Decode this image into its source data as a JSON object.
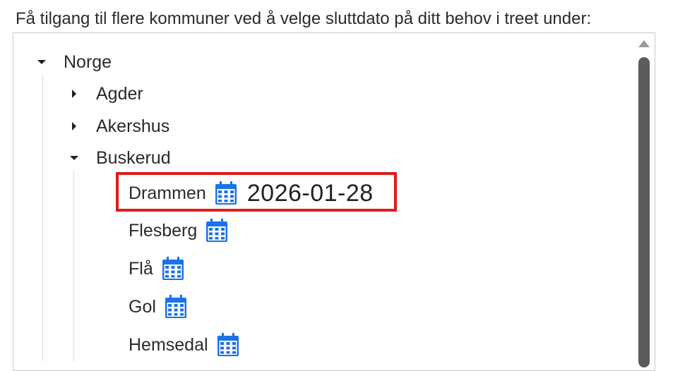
{
  "instruction": "Få tilgang til flere kommuner ved å velge sluttdato på ditt behov i treet under:",
  "tree": {
    "root": {
      "label": "Norge",
      "expanded": true
    },
    "counties": [
      {
        "label": "Agder",
        "expanded": false
      },
      {
        "label": "Akershus",
        "expanded": false
      },
      {
        "label": "Buskerud",
        "expanded": true
      }
    ],
    "municipalities": [
      {
        "label": "Drammen",
        "date": "2026-01-28"
      },
      {
        "label": "Flesberg"
      },
      {
        "label": "Flå"
      },
      {
        "label": "Gol"
      },
      {
        "label": "Hemsedal"
      }
    ]
  },
  "colors": {
    "calendar_icon": "#1a73e8",
    "highlight_border": "#e01b1b",
    "scroll_thumb": "#5c5c5c"
  },
  "icons": {
    "calendar": "calendar-icon",
    "expand": "caret-down-icon",
    "collapse": "caret-right-icon"
  }
}
